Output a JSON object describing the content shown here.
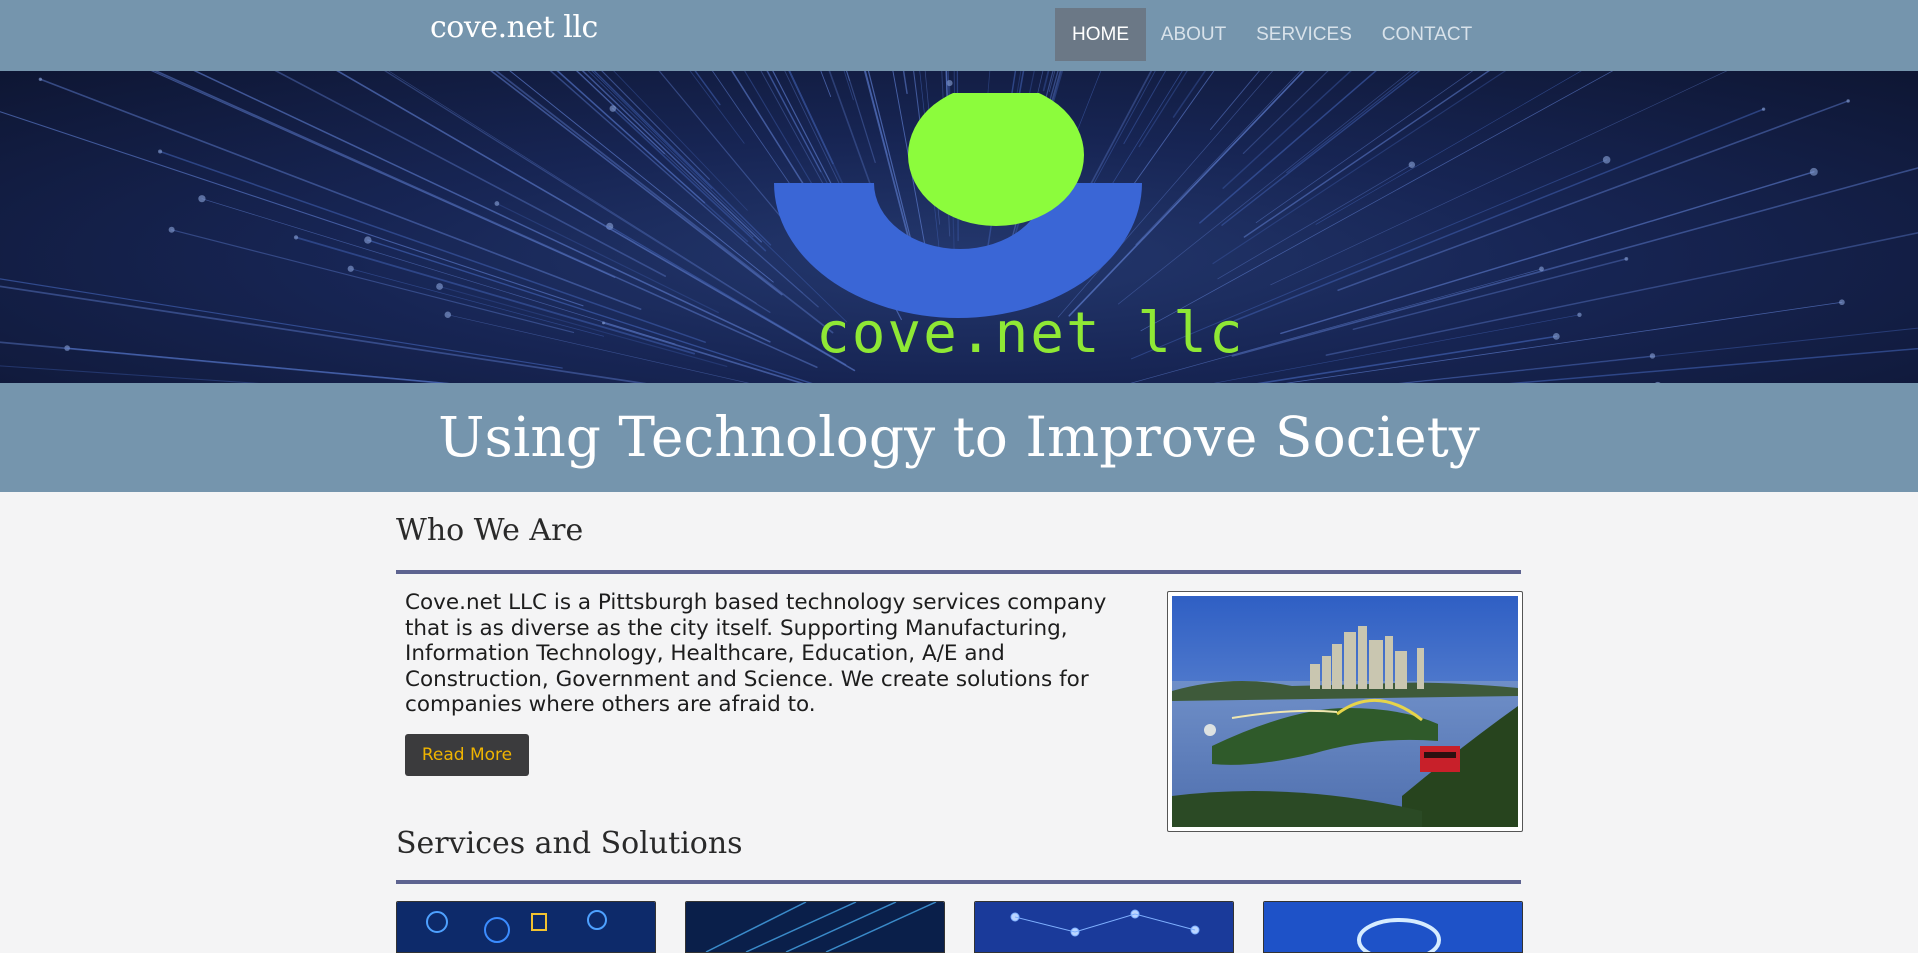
{
  "navbar": {
    "brand": "cove.net llc",
    "items": [
      {
        "label": "HOME",
        "active": true
      },
      {
        "label": "ABOUT",
        "active": false
      },
      {
        "label": "SERVICES",
        "active": false
      },
      {
        "label": "CONTACT",
        "active": false
      }
    ]
  },
  "hero": {
    "logo_text": "cove.net llc",
    "logo_colors": {
      "blue": "#3a66d6",
      "green": "#8cfc3c"
    }
  },
  "banner": {
    "title": "Using Technology to Improve Society"
  },
  "who_we_are": {
    "title": "Who We Are",
    "body": "Cove.net LLC is a Pittsburgh based technology services company that is as diverse as the city itself. Supporting Manufacturing, Information Technology, Healthcare, Education, A/E and Construction, Government and Science. We create solutions for companies where others are afraid to.",
    "button": "Read More"
  },
  "services": {
    "title": "Services and Solutions"
  },
  "colors": {
    "nav_bg": "#7595ad",
    "active_nav": "#6b7886",
    "rule": "#5d6390",
    "button_bg": "#3b3b3d",
    "button_text": "#f0b400"
  }
}
